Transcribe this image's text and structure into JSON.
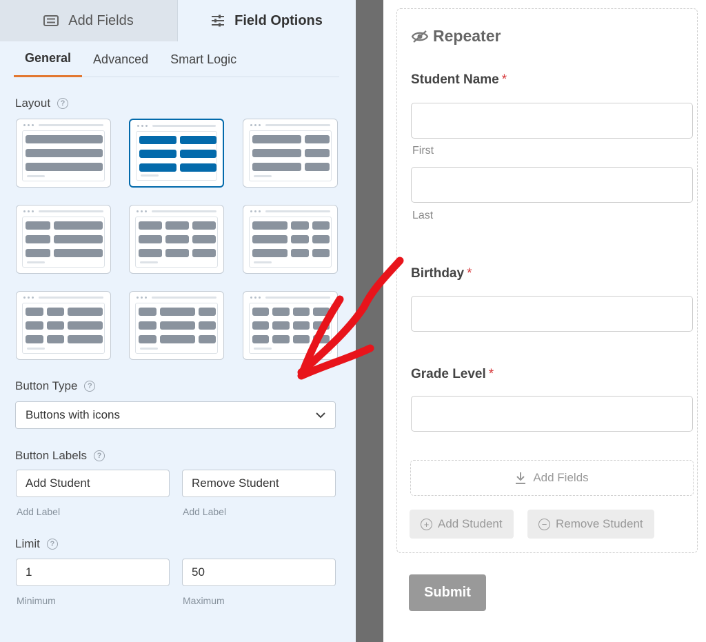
{
  "tabs": {
    "add_fields": "Add Fields",
    "field_options": "Field Options"
  },
  "subtabs": [
    "General",
    "Advanced",
    "Smart Logic"
  ],
  "layout": {
    "label": "Layout",
    "selected_index": 1
  },
  "button_type": {
    "label": "Button Type",
    "value": "Buttons with icons"
  },
  "button_labels": {
    "label": "Button Labels",
    "add_value": "Add Student",
    "remove_value": "Remove Student",
    "add_sublabel": "Add Label",
    "remove_sublabel": "Add Label"
  },
  "limit": {
    "label": "Limit",
    "min_value": "1",
    "max_value": "50",
    "min_sublabel": "Minimum",
    "max_sublabel": "Maximum"
  },
  "preview": {
    "repeater_title": "Repeater",
    "student_name_label": "Student Name",
    "first_sublabel": "First",
    "last_sublabel": "Last",
    "birthday_label": "Birthday",
    "grade_label": "Grade Level",
    "required_mark": "*",
    "add_fields": "Add Fields",
    "add_student": "Add Student",
    "remove_student": "Remove Student",
    "submit": "Submit"
  },
  "colors": {
    "accent_blue": "#036aab",
    "tab_underline": "#e27730",
    "arrow_red": "#e8141b",
    "required_red": "#d63638"
  }
}
